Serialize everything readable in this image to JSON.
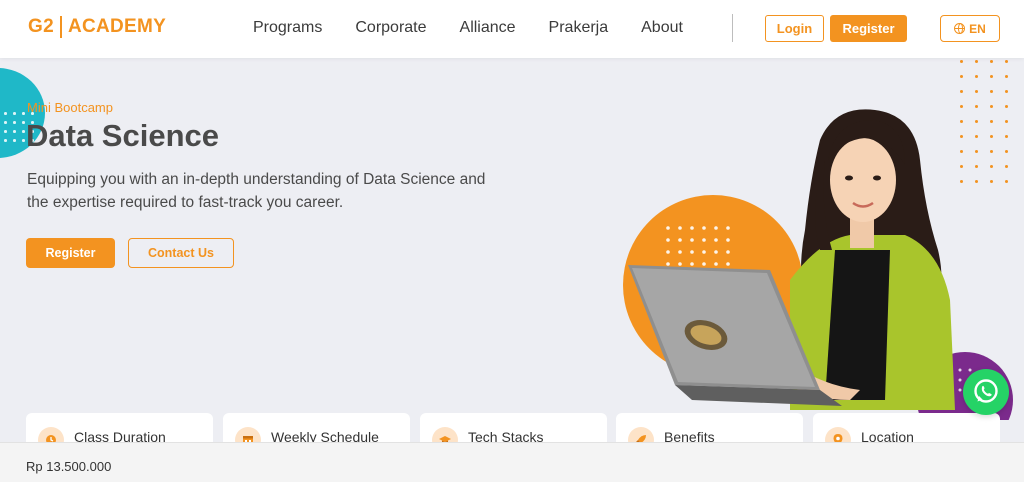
{
  "header": {
    "logo_left": "G2",
    "logo_right": "ACADEMY",
    "nav": [
      "Programs",
      "Corporate",
      "Alliance",
      "Prakerja",
      "About"
    ],
    "login_label": "Login",
    "register_label": "Register",
    "language_label": "EN"
  },
  "hero": {
    "eyebrow": "Mini Bootcamp",
    "title": "Data Science",
    "description": "Equipping you with an in-depth understanding of Data Science and the expertise required to fast-track you career.",
    "register_label": "Register",
    "contact_label": "Contact Us"
  },
  "cards": [
    {
      "label": "Class Duration",
      "icon": "clock-icon"
    },
    {
      "label": "Weekly Schedule",
      "icon": "calendar-icon"
    },
    {
      "label": "Tech Stacks",
      "icon": "graduation-cap-icon"
    },
    {
      "label": "Benefits",
      "icon": "rocket-icon"
    },
    {
      "label": "Location",
      "icon": "location-pin-icon"
    }
  ],
  "bottom_bar": {
    "price": "Rp 13.500.000"
  },
  "colors": {
    "brand_orange": "#f39320",
    "accent_teal": "#1fb8c8",
    "accent_purple": "#7b2a8c",
    "whatsapp_green": "#25d366"
  }
}
